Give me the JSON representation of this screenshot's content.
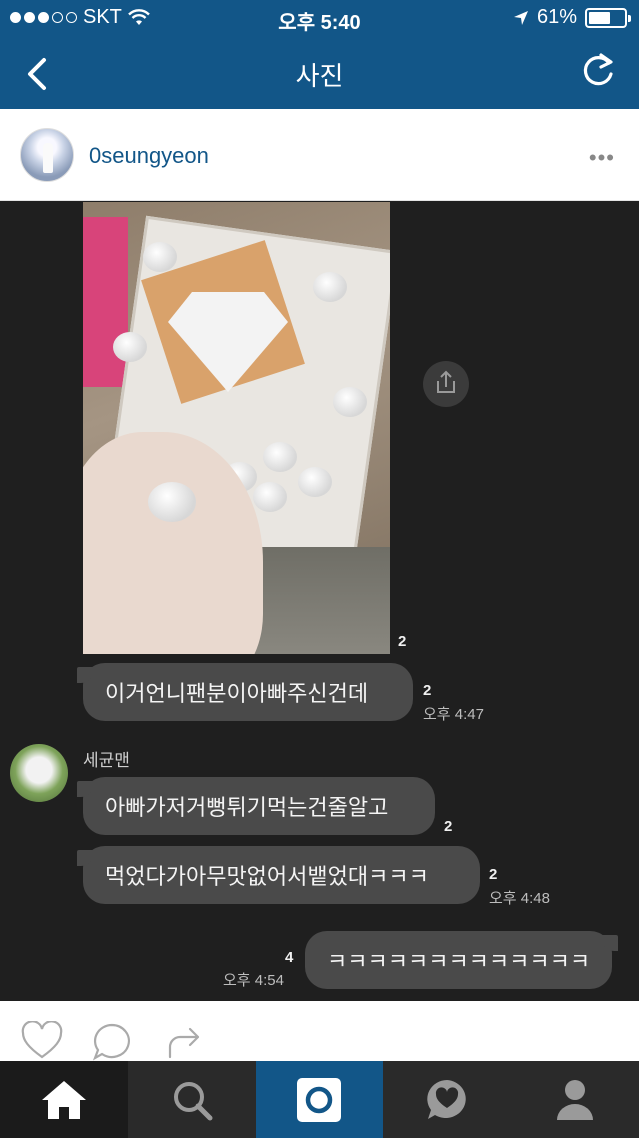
{
  "status_bar": {
    "carrier": "SKT",
    "time": "오후 5:40",
    "battery": "61%",
    "battery_level": 0.61
  },
  "header": {
    "title": "사진",
    "back_icon": "chevron-left-icon",
    "refresh_icon": "refresh-icon"
  },
  "post": {
    "username": "0seungyeon",
    "more_icon": "ellipsis-icon"
  },
  "chat": {
    "photo_count": "2",
    "messages": [
      {
        "text": "이거언니팬분이아빠주신건데",
        "count": "2",
        "time": "오후 4:47"
      },
      {
        "sender": "세균맨",
        "text": "아빠가저거뻥튀기먹는건줄알고",
        "count": "2"
      },
      {
        "text": "먹었다가아무맛없어서뱉었대ㅋㅋㅋ",
        "count": "2",
        "time": "오후 4:48"
      },
      {
        "text": "ㅋㅋㅋㅋㅋㅋㅋㅋㅋㅋㅋㅋㅋ",
        "count": "4",
        "time": "오후 4:54"
      }
    ]
  },
  "actions": {
    "like_icon": "heart-icon",
    "comment_icon": "comment-icon",
    "share_icon": "share-icon"
  },
  "tabs": [
    "home-icon",
    "search-icon",
    "camera-icon",
    "activity-icon",
    "profile-icon"
  ],
  "colors": {
    "brand": "#125688",
    "chat_bg": "#1f1f1f",
    "bubble": "#4a4a4a"
  }
}
